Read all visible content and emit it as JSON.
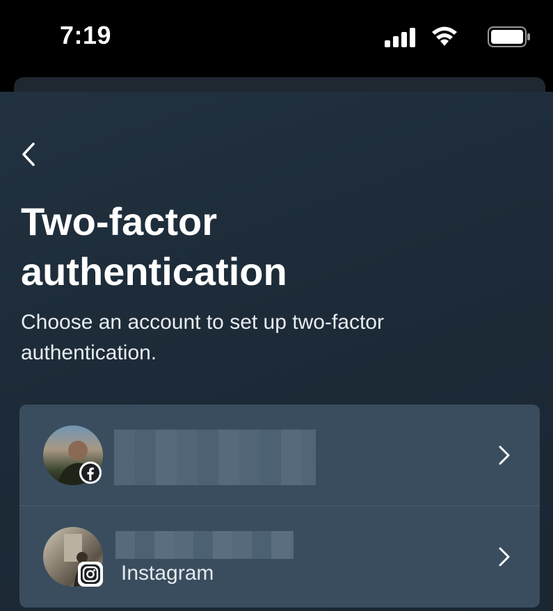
{
  "status_bar": {
    "time": "7:19",
    "icons": [
      "signal-icon",
      "wifi-icon",
      "battery-icon"
    ]
  },
  "page": {
    "title_line1": "Two-factor",
    "title_line2": "authentication",
    "subtitle": "Choose an account to set up two-factor authentication."
  },
  "accounts": [
    {
      "platform_icon": "facebook-icon",
      "platform_label": "",
      "name_redacted": true
    },
    {
      "platform_icon": "instagram-icon",
      "platform_label": "Instagram",
      "name_redacted": true
    }
  ],
  "colors": {
    "background": "#1d2b38",
    "card": "#3a4d5e",
    "text": "#ffffff"
  }
}
